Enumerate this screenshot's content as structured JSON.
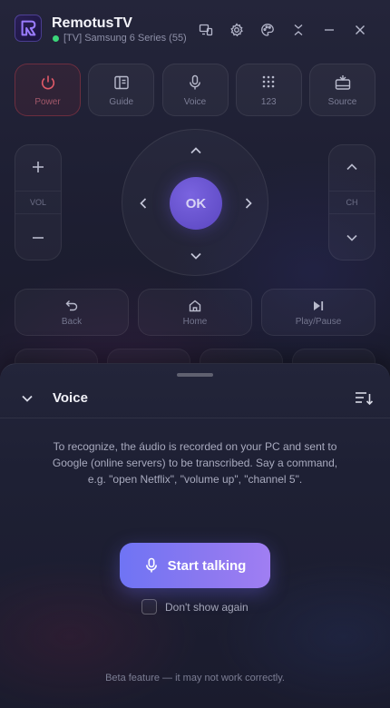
{
  "app": {
    "title": "RemotusTV",
    "device_status": "[TV] Samsung 6 Series (55)",
    "connected_color": "#3bd67a"
  },
  "titlebar_icons": [
    "devices-icon",
    "settings-icon",
    "palette-icon",
    "collapse-icon",
    "minimize-icon",
    "close-icon"
  ],
  "top_buttons": {
    "power": "Power",
    "guide": "Guide",
    "voice": "Voice",
    "numpad": "123",
    "source": "Source"
  },
  "volume": {
    "label": "VOL",
    "plus": "+",
    "minus": "−"
  },
  "channel": {
    "label": "CH"
  },
  "dpad": {
    "ok": "OK"
  },
  "nav_buttons": {
    "back": "Back",
    "home": "Home",
    "play_pause": "Play/Pause"
  },
  "voice_sheet": {
    "title": "Voice",
    "info": "To recognize, the áudio is recorded on your PC and sent to Google (online servers) to be transcribed. Say a command, e.g. \"open Netflix\", \"volume up\", \"channel 5\".",
    "start_button": "Start talking",
    "dont_show_again": "Don't show again",
    "dont_show_checked": false,
    "beta_note": "Beta feature — it may not work correctly."
  },
  "colors": {
    "accent": "#7c72f2",
    "power": "#e05a68",
    "background": "#1b1c2c"
  }
}
